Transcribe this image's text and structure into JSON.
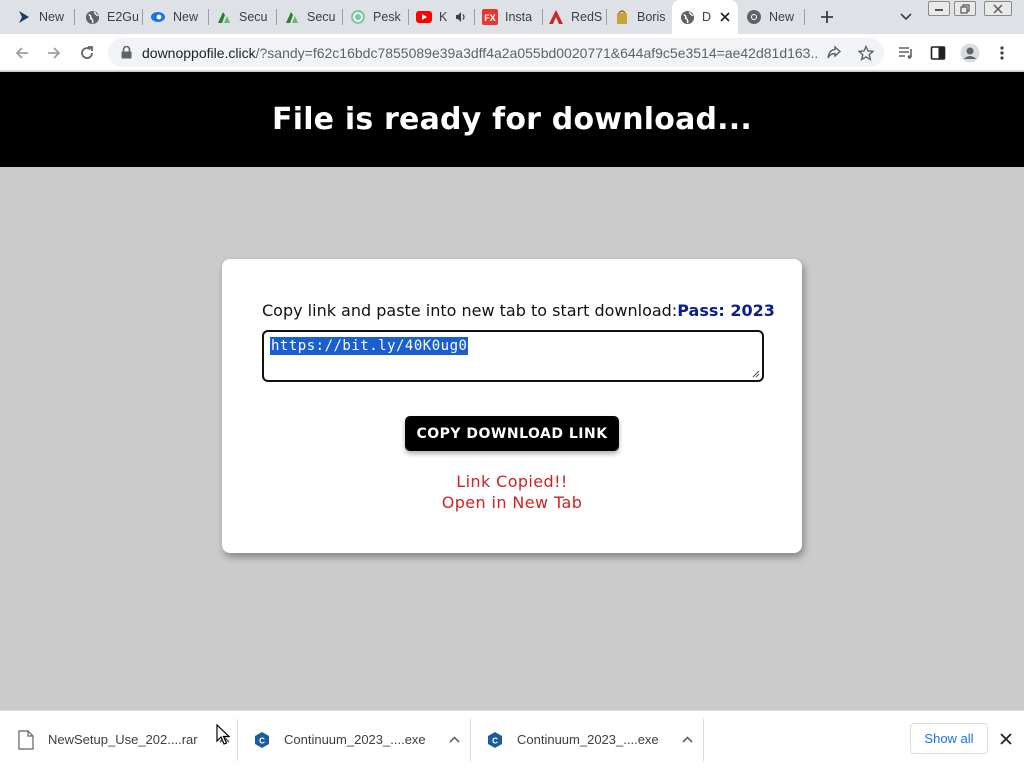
{
  "tabs": [
    {
      "title": "New",
      "icon": "arrow-logo-icon"
    },
    {
      "title": "E2Gu",
      "icon": "globe-icon"
    },
    {
      "title": "New",
      "icon": "eye-logo-icon"
    },
    {
      "title": "Secu",
      "icon": "shield-logo-icon"
    },
    {
      "title": "Secu",
      "icon": "shield-logo-icon"
    },
    {
      "title": "Pesk",
      "icon": "chat-logo-icon"
    },
    {
      "title": "K",
      "icon": "youtube-icon"
    },
    {
      "title": "Insta",
      "icon": "fx-logo-icon"
    },
    {
      "title": "RedS",
      "icon": "redshift-logo-icon"
    },
    {
      "title": "Boris",
      "icon": "bag-logo-icon"
    },
    {
      "title": "D",
      "icon": "globe-icon"
    },
    {
      "title": "New",
      "icon": "chrome-icon"
    }
  ],
  "address": {
    "host": "downoppofile.click",
    "path": "/?sandy=f62c16bdc7855089e39a3dff4a2a055bd0020771&644af9c5e3514=ae42d81d163..."
  },
  "page": {
    "heading": "File is ready for download...",
    "instruction": "Copy link and paste into new tab to start download:",
    "password": "Pass: 2023",
    "link": "https://bit.ly/40K0ug0",
    "button": "COPY DOWNLOAD LINK",
    "status_line1": "Link Copied!!",
    "status_line2": "Open in New Tab"
  },
  "downloads": {
    "items": [
      {
        "name": "NewSetup_Use_202....rar",
        "icon": "file-icon"
      },
      {
        "name": "Continuum_2023_....exe",
        "icon": "installer-icon"
      },
      {
        "name": "Continuum_2023_....exe",
        "icon": "installer-icon"
      }
    ],
    "show_all": "Show all"
  },
  "colors": {
    "hero_bg": "#000000",
    "page_bg": "#cbcbcb",
    "password": "#0b1d8f",
    "status": "#d32020",
    "selection": "#1a5fd0",
    "link_blue": "#1a73e8"
  }
}
